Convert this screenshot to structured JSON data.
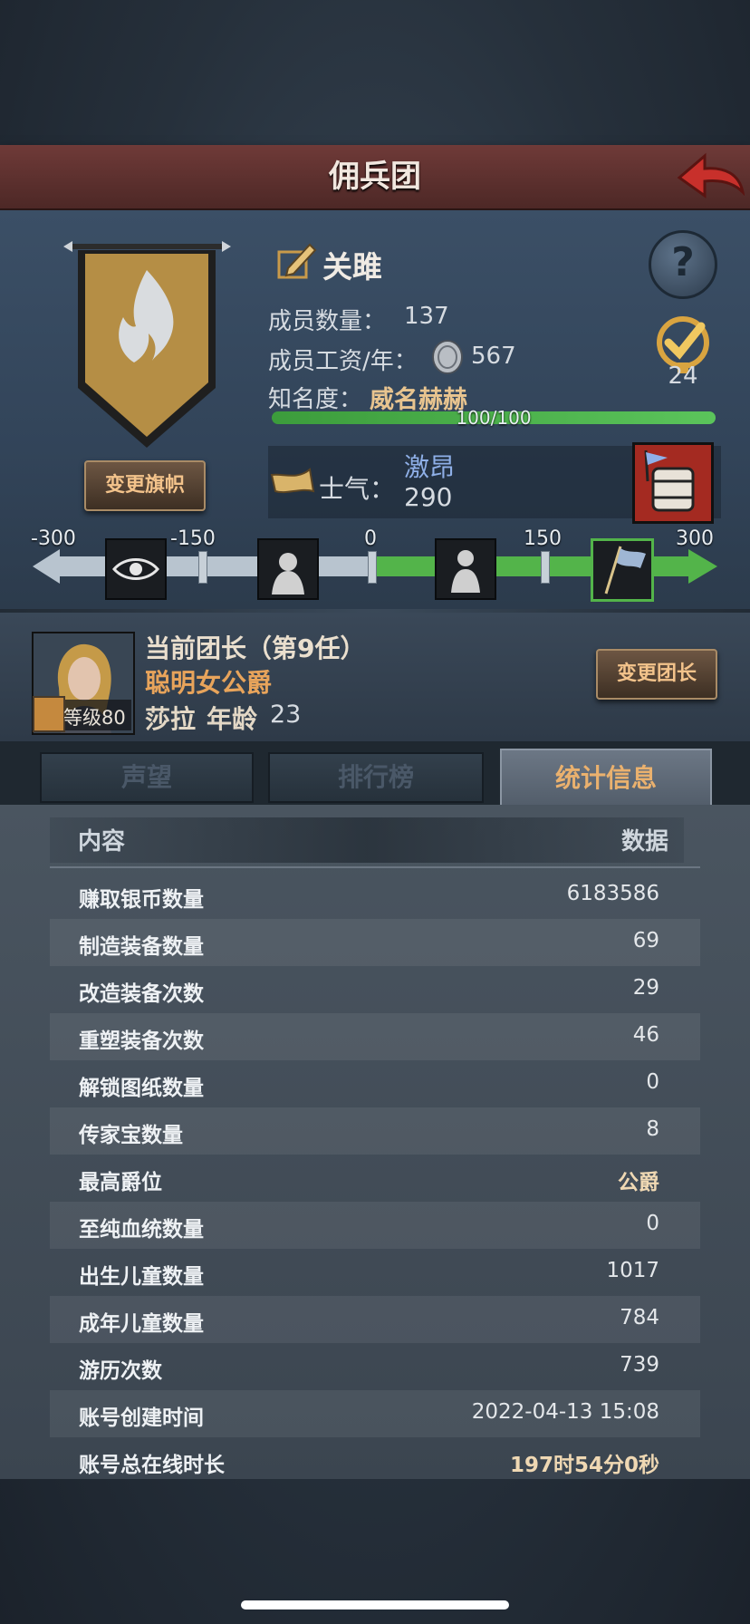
{
  "header": {
    "title": "佣兵团"
  },
  "guild": {
    "name": "关雎",
    "members_label": "成员数量：",
    "members_value": "137",
    "salary_label": "成员工资/年：",
    "salary_value": "567",
    "fame_label": "知名度：",
    "fame_value": "威名赫赫",
    "fame_progress_text": "100/100",
    "fame_progress_fraction": 1.0,
    "medal_count": "24",
    "change_flag_label": "变更旗帜"
  },
  "morale": {
    "label": "士气：",
    "state": "激昂",
    "value": "290",
    "scale_ticks": [
      "-300",
      "-150",
      "0",
      "150",
      "300"
    ]
  },
  "leader": {
    "title": "当前团长（第9任）",
    "trait": "聪明女公爵",
    "name": "莎拉",
    "age_label": "年龄",
    "age": "23",
    "level_text": "等级80",
    "change_label": "变更团长"
  },
  "tabs": [
    {
      "label": "声望",
      "active": false
    },
    {
      "label": "排行榜",
      "active": false
    },
    {
      "label": "统计信息",
      "active": true
    }
  ],
  "table": {
    "header_left": "内容",
    "header_right": "数据",
    "rows": [
      {
        "label": "赚取银币数量",
        "value": "6183586"
      },
      {
        "label": "制造装备数量",
        "value": "69"
      },
      {
        "label": "改造装备次数",
        "value": "29"
      },
      {
        "label": "重塑装备次数",
        "value": "46"
      },
      {
        "label": "解锁图纸数量",
        "value": "0"
      },
      {
        "label": "传家宝数量",
        "value": "8"
      },
      {
        "label": "最高爵位",
        "value": "公爵"
      },
      {
        "label": "至纯血统数量",
        "value": "0"
      },
      {
        "label": "出生儿童数量",
        "value": "1017"
      },
      {
        "label": "成年儿童数量",
        "value": "784"
      },
      {
        "label": "游历次数",
        "value": "739"
      },
      {
        "label": "账号创建时间",
        "value": "2022-04-13 15:08"
      },
      {
        "label": "账号总在线时长",
        "value": "197时54分0秒"
      }
    ]
  },
  "colors": {
    "title_bar": "#6f3a38",
    "accent_gold": "#e8a45b",
    "morale_green": "#53b44a",
    "morale_blue_text": "#8fb0e8"
  }
}
